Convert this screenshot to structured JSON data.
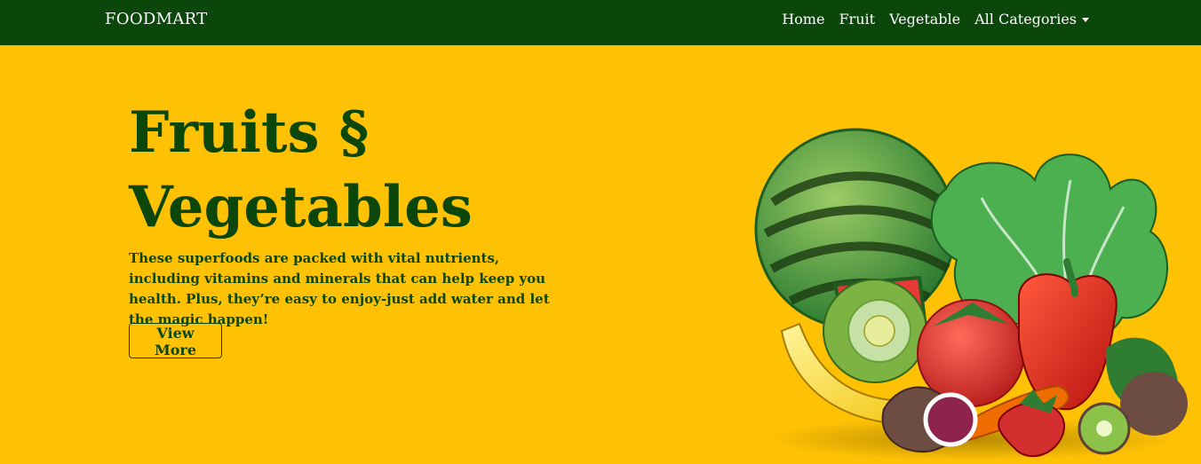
{
  "navbar": {
    "brand": "FOODMART",
    "links": [
      {
        "label": "Home"
      },
      {
        "label": "Fruit"
      },
      {
        "label": "Vegetable"
      },
      {
        "label": "All Categories"
      }
    ]
  },
  "hero": {
    "title_line1": "Fruits §",
    "title_line2": "Vegetables",
    "description": "These superfoods are packed with vital nutrients, including vitamins and minerals that can help keep you health. Plus, they’re easy to enjoy-just add water and let the magic happen!",
    "button_label": "View More"
  },
  "colors": {
    "navbar_bg": "#0b470a",
    "hero_bg": "#fec104",
    "accent_text": "#0b470a"
  }
}
